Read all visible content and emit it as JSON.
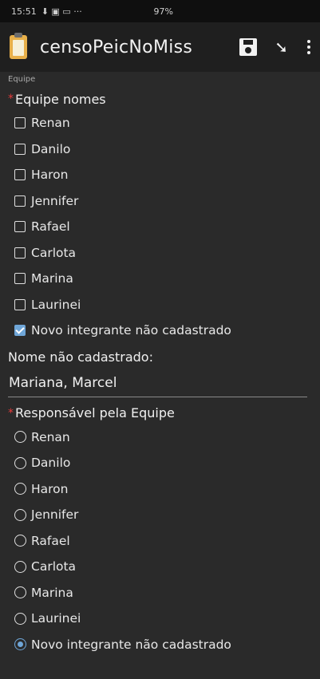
{
  "status_bar": {
    "time": "15:51",
    "battery": "97%"
  },
  "app_bar": {
    "title": "censoPeicNoMiss"
  },
  "form": {
    "group_label": "Equipe",
    "team_members": {
      "label": "Equipe nomes",
      "options": [
        {
          "label": "Renan",
          "checked": false
        },
        {
          "label": "Danilo",
          "checked": false
        },
        {
          "label": "Haron",
          "checked": false
        },
        {
          "label": "Jennifer",
          "checked": false
        },
        {
          "label": "Rafael",
          "checked": false
        },
        {
          "label": "Carlota",
          "checked": false
        },
        {
          "label": "Marina",
          "checked": false
        },
        {
          "label": "Laurinei",
          "checked": false
        },
        {
          "label": "Novo integrante não cadastrado",
          "checked": true
        }
      ]
    },
    "unregistered_name": {
      "label": "Nome não cadastrado:",
      "value": "Mariana, Marcel"
    },
    "team_leader": {
      "label": "Responsável pela Equipe",
      "options": [
        {
          "label": "Renan",
          "selected": false
        },
        {
          "label": "Danilo",
          "selected": false
        },
        {
          "label": "Haron",
          "selected": false
        },
        {
          "label": "Jennifer",
          "selected": false
        },
        {
          "label": "Rafael",
          "selected": false
        },
        {
          "label": "Carlota",
          "selected": false
        },
        {
          "label": "Marina",
          "selected": false
        },
        {
          "label": "Laurinei",
          "selected": false
        },
        {
          "label": "Novo integrante não cadastrado",
          "selected": true
        }
      ]
    }
  },
  "colors": {
    "accent": "#6fa6d8",
    "required": "#e43b3b",
    "background": "#2a2a2a"
  }
}
